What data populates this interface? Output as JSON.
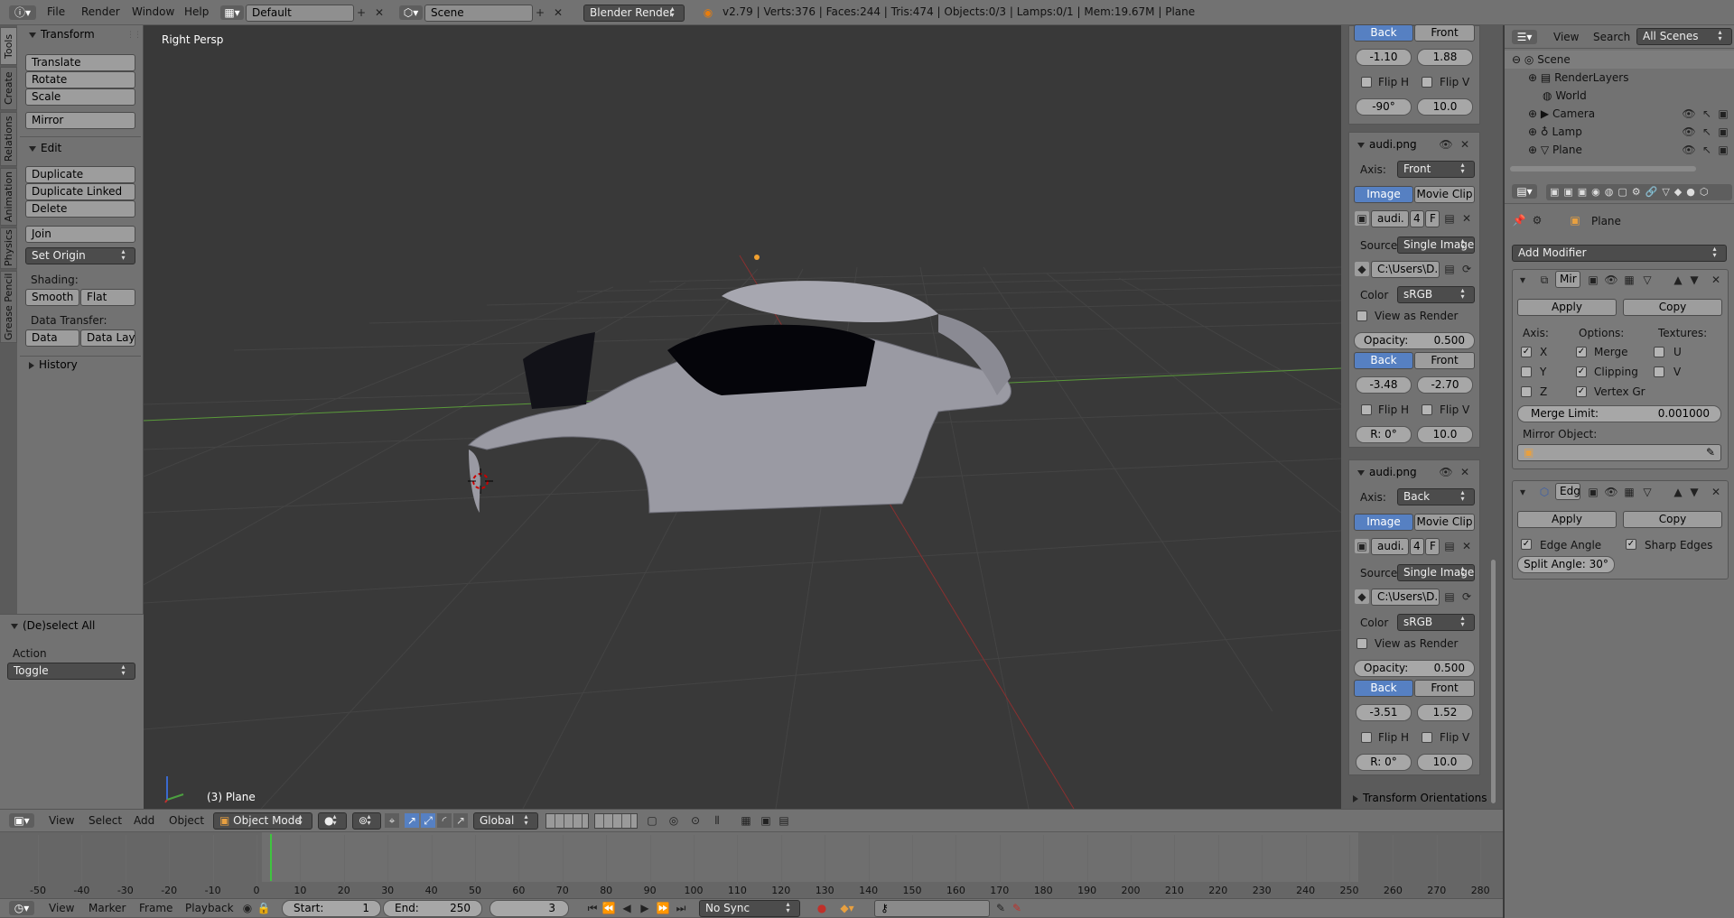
{
  "info_bar": {
    "menus": [
      "File",
      "Render",
      "Window",
      "Help"
    ],
    "layout": "Default",
    "scene": "Scene",
    "engine": "Blender Render",
    "stats": "v2.79 | Verts:376 | Faces:244 | Tris:474 | Objects:0/3 | Lamps:0/1 | Mem:19.67M | Plane"
  },
  "viewport": {
    "label": "Right Persp",
    "object_label": "(3) Plane"
  },
  "vtabs": [
    "Tools",
    "Create",
    "Relations",
    "Animation",
    "Physics",
    "Grease Pencil"
  ],
  "tools": {
    "transform_title": "Transform",
    "translate": "Translate",
    "rotate": "Rotate",
    "scale": "Scale",
    "mirror": "Mirror",
    "edit_title": "Edit",
    "duplicate": "Duplicate",
    "duplicate_linked": "Duplicate Linked",
    "delete": "Delete",
    "join": "Join",
    "set_origin": "Set Origin",
    "shading_label": "Shading:",
    "smooth": "Smooth",
    "flat": "Flat",
    "data_transfer_label": "Data Transfer:",
    "data": "Data",
    "data_layout": "Data Layo",
    "history_title": "History"
  },
  "operator": {
    "title": "(De)select All",
    "action_label": "Action",
    "action_value": "Toggle"
  },
  "bg_panel": {
    "top": {
      "back": "Back",
      "front": "Front",
      "x": "-1.10",
      "y": "1.88",
      "flip_h": "Flip H",
      "flip_v": "Flip V",
      "rot": "-90°",
      "size": "10.0"
    },
    "img1": {
      "title": "audi.png",
      "axis_label": "Axis:",
      "axis": "Front",
      "image_tab": "Image",
      "movie_tab": "Movie Clip",
      "file": "audi.",
      "users": "4",
      "fake": "F",
      "source_label": "Source",
      "source": "Single Image",
      "path": "C:\\Users\\D...",
      "color_label": "Color",
      "color": "sRGB",
      "view_as_render": "View as Render",
      "opacity_label": "Opacity:",
      "opacity": "0.500",
      "back": "Back",
      "front": "Front",
      "x": "-3.48",
      "y": "-2.70",
      "flip_h": "Flip H",
      "flip_v": "Flip V",
      "rot": "R: 0°",
      "size": "10.0"
    },
    "img2": {
      "title": "audi.png",
      "axis_label": "Axis:",
      "axis": "Back",
      "image_tab": "Image",
      "movie_tab": "Movie Clip",
      "file": "audi.",
      "users": "4",
      "fake": "F",
      "source_label": "Source",
      "source": "Single Image",
      "path": "C:\\Users\\D...",
      "color_label": "Color",
      "color": "sRGB",
      "view_as_render": "View as Render",
      "opacity_label": "Opacity:",
      "opacity": "0.500",
      "back": "Back",
      "front": "Front",
      "x": "-3.51",
      "y": "1.52",
      "flip_h": "Flip H",
      "flip_v": "Flip V",
      "rot": "R: 0°",
      "size": "10.0"
    },
    "transform_orientations": "Transform Orientations"
  },
  "outliner": {
    "view": "View",
    "search": "Search",
    "filter": "All Scenes",
    "scene": "Scene",
    "render_layers": "RenderLayers",
    "world": "World",
    "camera": "Camera",
    "lamp": "Lamp",
    "plane": "Plane"
  },
  "properties": {
    "object": "Plane",
    "add_modifier": "Add Modifier",
    "mirror": {
      "name": "Mir",
      "apply": "Apply",
      "copy": "Copy",
      "axis_label": "Axis:",
      "options_label": "Options:",
      "textures_label": "Textures:",
      "x": "X",
      "y": "Y",
      "z": "Z",
      "merge": "Merge",
      "clipping": "Clipping",
      "vertex_groups": "Vertex Gr",
      "u": "U",
      "v": "V",
      "merge_limit_label": "Merge Limit:",
      "merge_limit": "0.001000",
      "mirror_object_label": "Mirror Object:"
    },
    "edge": {
      "name": "Edg",
      "apply": "Apply",
      "copy": "Copy",
      "edge_angle": "Edge Angle",
      "sharp_edges": "Sharp Edges",
      "split_angle": "Split Angle: 30°"
    }
  },
  "view3d_header": {
    "view": "View",
    "select": "Select",
    "add": "Add",
    "object": "Object",
    "mode": "Object Mode",
    "orientation": "Global"
  },
  "timeline": {
    "ticks": [
      "-50",
      "-40",
      "-30",
      "-20",
      "-10",
      "0",
      "10",
      "20",
      "30",
      "40",
      "50",
      "60",
      "70",
      "80",
      "90",
      "100",
      "110",
      "120",
      "130",
      "140",
      "150",
      "160",
      "170",
      "180",
      "190",
      "200",
      "210",
      "220",
      "230",
      "240",
      "250",
      "260",
      "270",
      "280"
    ],
    "current_frame": 3,
    "view": "View",
    "marker": "Marker",
    "frame": "Frame",
    "playback": "Playback",
    "start": "Start:",
    "start_value": "1",
    "end": "End:",
    "end_value": "250",
    "current": "3",
    "sync": "No Sync"
  }
}
